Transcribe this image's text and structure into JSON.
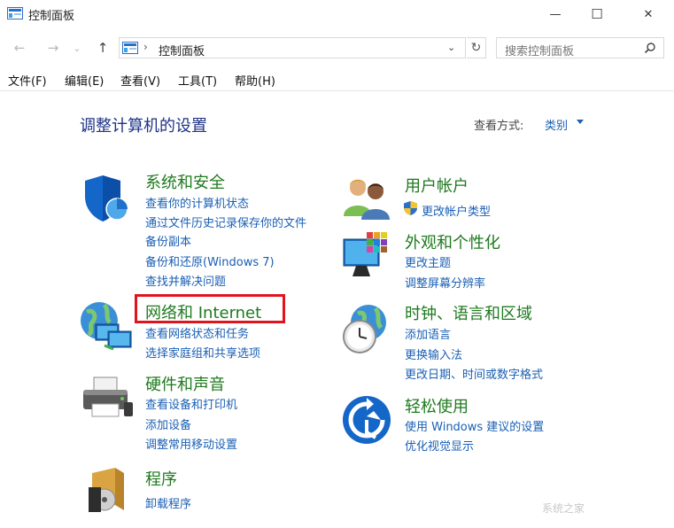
{
  "window": {
    "title": "控制面板",
    "minimize_glyph": "—",
    "maximize_glyph": "☐",
    "close_glyph": "✕"
  },
  "nav": {
    "back_glyph": "←",
    "forward_glyph": "→",
    "recent_glyph": "⌄",
    "up_glyph": "↑",
    "breadcrumb_sep": "›",
    "breadcrumb": "控制面板",
    "dropdown_glyph": "⌄",
    "refresh_glyph": "↻",
    "search_placeholder": "搜索控制面板"
  },
  "menu": [
    "文件(F)",
    "编辑(E)",
    "查看(V)",
    "工具(T)",
    "帮助(H)"
  ],
  "content": {
    "heading": "调整计算机的设置",
    "view_by_label": "查看方式:",
    "view_by_value": "类别"
  },
  "categories": {
    "system_security": {
      "title": "系统和安全",
      "links": [
        "查看你的计算机状态",
        "通过文件历史记录保存你的文件",
        "备份副本",
        "备份和还原(Windows 7)",
        "查找并解决问题"
      ]
    },
    "network": {
      "title": "网络和 Internet",
      "links": [
        "查看网络状态和任务",
        "选择家庭组和共享选项"
      ]
    },
    "hardware": {
      "title": "硬件和声音",
      "links": [
        "查看设备和打印机",
        "添加设备",
        "调整常用移动设置"
      ]
    },
    "programs": {
      "title": "程序",
      "links": [
        "卸载程序"
      ]
    },
    "user_accounts": {
      "title": "用户帐户",
      "links": [
        "更改帐户类型"
      ]
    },
    "appearance": {
      "title": "外观和个性化",
      "links": [
        "更改主题",
        "调整屏幕分辨率"
      ]
    },
    "clock_region": {
      "title": "时钟、语言和区域",
      "links": [
        "添加语言",
        "更换输入法",
        "更改日期、时间或数字格式"
      ]
    },
    "ease_access": {
      "title": "轻松使用",
      "links": [
        "使用 Windows 建议的设置",
        "优化视觉显示"
      ]
    }
  },
  "watermark": "系统之家",
  "colors": {
    "heading": "#1e3287",
    "category_title": "#1e7a1e",
    "link": "#1a5fb4",
    "highlight_box": "#e0141e"
  }
}
